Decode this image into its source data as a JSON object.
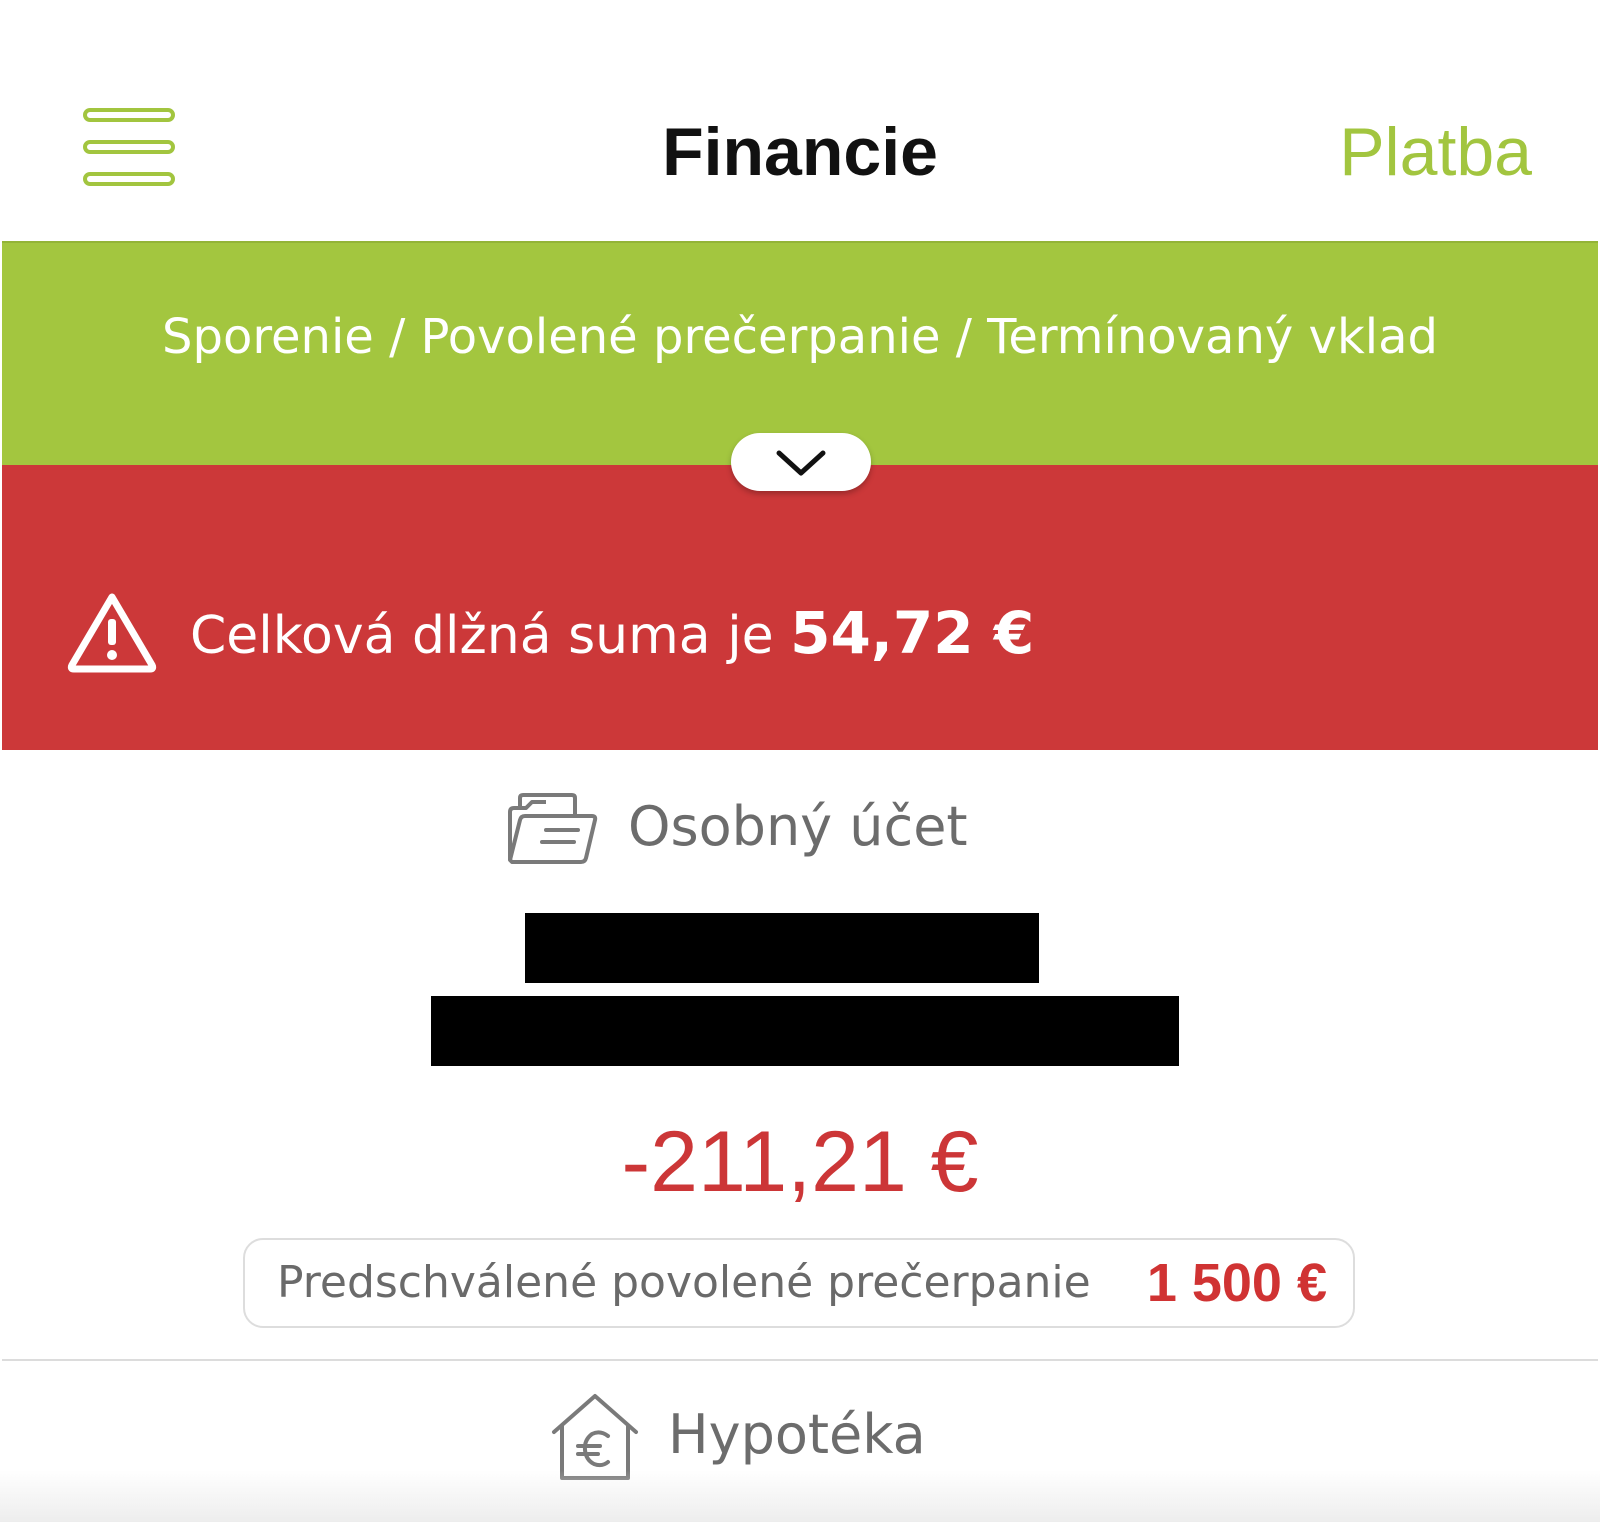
{
  "header": {
    "title": "Financie",
    "action_label": "Platba"
  },
  "tabs": {
    "items": [
      "Sporenie",
      "Povolené prečerpanie",
      "Termínovaný vklad"
    ],
    "separator": " / "
  },
  "alert": {
    "text": "Celková dlžná suma je ",
    "amount": "54,72 €"
  },
  "account": {
    "type_label": "Osobný účet",
    "balance": "-211,21 €",
    "overdraft_label": "Predschválené povolené prečerpanie",
    "overdraft_amount": "1 500 €"
  },
  "mortgage": {
    "label": "Hypotéka"
  },
  "icons": {
    "menu": "hamburger-menu-icon",
    "expand": "chevron-down-icon",
    "alert": "warning-triangle-icon",
    "account": "folder-icon",
    "mortgage": "house-euro-icon"
  },
  "colors": {
    "accent_green": "#a3c63f",
    "alert_red": "#cc3839",
    "negative_text": "#cc3637",
    "muted_text": "#6c6c6c"
  }
}
